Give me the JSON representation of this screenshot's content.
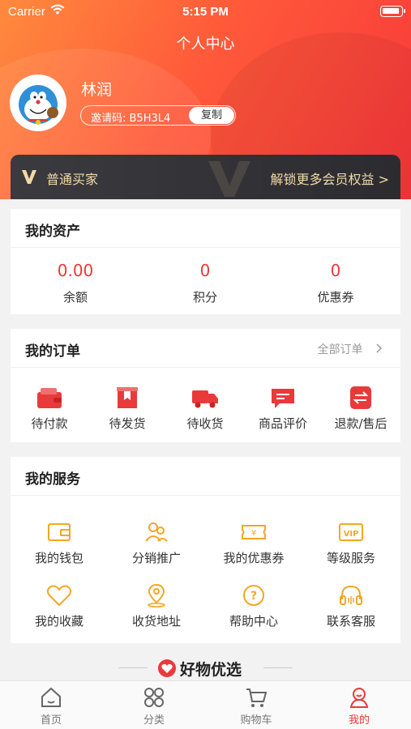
{
  "status_bar": {
    "carrier": "Carrier",
    "time": "5:15 PM"
  },
  "header": {
    "title": "个人中心",
    "username": "林润",
    "invite_code": "邀请码: B5H3L4",
    "copy_label": "复制"
  },
  "vip": {
    "level": "普通买家",
    "unlock": "解锁更多会员权益 >"
  },
  "assets": {
    "title": "我的资产",
    "items": [
      {
        "value": "0.00",
        "label": "余额"
      },
      {
        "value": "0",
        "label": "积分"
      },
      {
        "value": "0",
        "label": "优惠券"
      }
    ]
  },
  "orders": {
    "title": "我的订单",
    "all_label": "全部订单",
    "items": [
      {
        "label": "待付款",
        "icon": "wallet-icon"
      },
      {
        "label": "待发货",
        "icon": "package-icon"
      },
      {
        "label": "待收货",
        "icon": "truck-icon"
      },
      {
        "label": "商品评价",
        "icon": "comment-icon"
      },
      {
        "label": "退款/售后",
        "icon": "exchange-icon"
      }
    ]
  },
  "services": {
    "title": "我的服务",
    "items": [
      {
        "label": "我的钱包",
        "icon": "wallet-outline-icon"
      },
      {
        "label": "分销推广",
        "icon": "users-icon"
      },
      {
        "label": "我的优惠券",
        "icon": "coupon-icon"
      },
      {
        "label": "等级服务",
        "icon": "vip-icon"
      },
      {
        "label": "我的收藏",
        "icon": "heart-icon"
      },
      {
        "label": "收货地址",
        "icon": "location-icon"
      },
      {
        "label": "帮助中心",
        "icon": "help-icon"
      },
      {
        "label": "联系客服",
        "icon": "headset-icon"
      }
    ]
  },
  "goods": {
    "title": "好物优选"
  },
  "tabbar": {
    "items": [
      {
        "label": "首页",
        "icon": "home-icon"
      },
      {
        "label": "分类",
        "icon": "grid-icon"
      },
      {
        "label": "购物车",
        "icon": "cart-icon"
      },
      {
        "label": "我的",
        "icon": "profile-icon"
      }
    ],
    "active_index": 3
  },
  "colors": {
    "accent": "#e83a3a",
    "service_icon": "#f5a623",
    "vip_text": "#f3d9a6"
  }
}
